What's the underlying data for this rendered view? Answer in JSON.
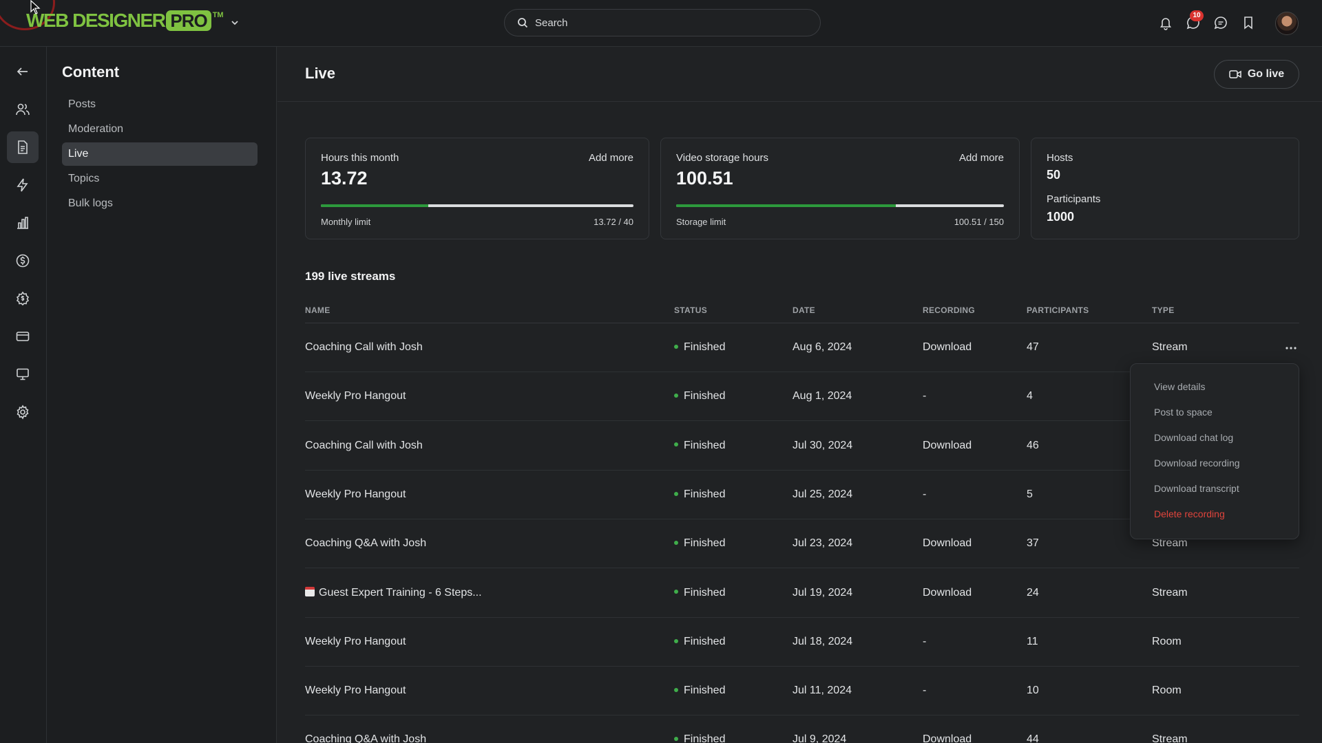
{
  "app": {
    "logo_main": "WEB DESIGNER",
    "logo_pro": "PRO",
    "logo_tm": "TM"
  },
  "search": {
    "placeholder": "Search"
  },
  "notifications": {
    "messages_badge": "10"
  },
  "subnav": {
    "title": "Content",
    "items": [
      {
        "label": "Posts",
        "active": false
      },
      {
        "label": "Moderation",
        "active": false
      },
      {
        "label": "Live",
        "active": true
      },
      {
        "label": "Topics",
        "active": false
      },
      {
        "label": "Bulk logs",
        "active": false
      }
    ]
  },
  "page": {
    "title": "Live",
    "go_live_label": "Go live"
  },
  "stats": {
    "hours": {
      "label": "Hours this month",
      "action": "Add more",
      "value": "13.72",
      "limit_label": "Monthly limit",
      "limit_text": "13.72 / 40",
      "fraction": 0.343
    },
    "storage": {
      "label": "Video storage hours",
      "action": "Add more",
      "value": "100.51",
      "limit_label": "Storage limit",
      "limit_text": "100.51 / 150",
      "fraction": 0.67
    },
    "people": {
      "hosts_label": "Hosts",
      "hosts_value": "50",
      "participants_label": "Participants",
      "participants_value": "1000"
    }
  },
  "table": {
    "count_title": "199 live streams",
    "columns": {
      "name": "NAME",
      "status": "STATUS",
      "date": "DATE",
      "recording": "RECORDING",
      "participants": "PARTICIPANTS",
      "type": "TYPE"
    },
    "rows": [
      {
        "name": "Coaching Call with Josh",
        "status": "Finished",
        "date": "Aug 6, 2024",
        "recording": "Download",
        "participants": "47",
        "type": "Stream",
        "calendar": false
      },
      {
        "name": "Weekly Pro Hangout",
        "status": "Finished",
        "date": "Aug 1, 2024",
        "recording": "-",
        "participants": "4",
        "type": "",
        "calendar": false
      },
      {
        "name": "Coaching Call with Josh",
        "status": "Finished",
        "date": "Jul 30, 2024",
        "recording": "Download",
        "participants": "46",
        "type": "",
        "calendar": false
      },
      {
        "name": "Weekly Pro Hangout",
        "status": "Finished",
        "date": "Jul 25, 2024",
        "recording": "-",
        "participants": "5",
        "type": "",
        "calendar": false
      },
      {
        "name": "Coaching Q&A with Josh",
        "status": "Finished",
        "date": "Jul 23, 2024",
        "recording": "Download",
        "participants": "37",
        "type": "Stream",
        "calendar": false
      },
      {
        "name": "Guest Expert Training - 6 Steps...",
        "status": "Finished",
        "date": "Jul 19, 2024",
        "recording": "Download",
        "participants": "24",
        "type": "Stream",
        "calendar": true
      },
      {
        "name": "Weekly Pro Hangout",
        "status": "Finished",
        "date": "Jul 18, 2024",
        "recording": "-",
        "participants": "11",
        "type": "Room",
        "calendar": false
      },
      {
        "name": "Weekly Pro Hangout",
        "status": "Finished",
        "date": "Jul 11, 2024",
        "recording": "-",
        "participants": "10",
        "type": "Room",
        "calendar": false
      },
      {
        "name": "Coaching Q&A with Josh",
        "status": "Finished",
        "date": "Jul 9, 2024",
        "recording": "Download",
        "participants": "44",
        "type": "Stream",
        "calendar": false
      }
    ]
  },
  "row_menu": {
    "items": [
      "View details",
      "Post to space",
      "Download chat log",
      "Download recording",
      "Download transcript"
    ],
    "danger_item": "Delete recording"
  },
  "colors": {
    "brand": "#7fc241",
    "progress": "#2d9a3c",
    "status_finished": "#3fae4b",
    "danger": "#e0443c",
    "badge": "#d9332f"
  }
}
